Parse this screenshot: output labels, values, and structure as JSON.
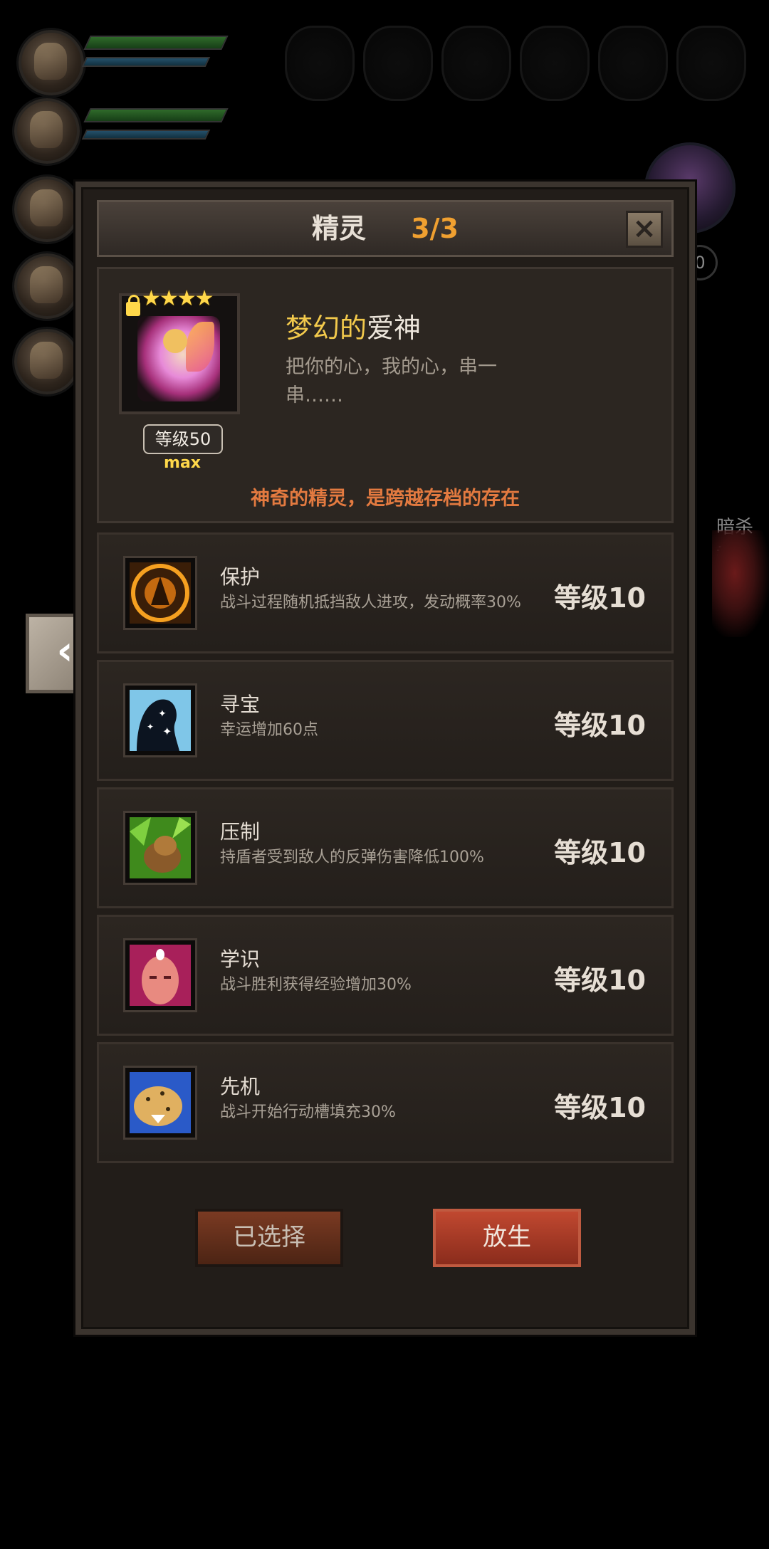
{
  "header": {
    "title": "精灵",
    "count": "3/3",
    "close_icon": "close-icon"
  },
  "spirit": {
    "stars": "★★★★",
    "level_label": "等级50",
    "max_label": "max",
    "name_part1": "梦幻的",
    "name_part2": "爱神",
    "description": "把你的心，我的心，串一串……",
    "note": "神奇的精灵，是跨越存档的存在"
  },
  "skills": [
    {
      "name": "保护",
      "desc": "战斗过程随机抵挡敌人进攻，发动概率30%",
      "level": "等级10",
      "icon": "protect-icon"
    },
    {
      "name": "寻宝",
      "desc": "幸运增加60点",
      "level": "等级10",
      "icon": "treasure-icon"
    },
    {
      "name": "压制",
      "desc": "持盾者受到敌人的反弹伤害降低100%",
      "level": "等级10",
      "icon": "suppress-icon"
    },
    {
      "name": "学识",
      "desc": "战斗胜利获得经验增加30%",
      "level": "等级10",
      "icon": "knowledge-icon"
    },
    {
      "name": "先机",
      "desc": "战斗开始行动槽填充30%",
      "level": "等级10",
      "icon": "initiative-icon"
    }
  ],
  "buttons": {
    "selected": "已选择",
    "release": "放生"
  },
  "background": {
    "side_label": "暗杀者",
    "side_level": "0"
  }
}
